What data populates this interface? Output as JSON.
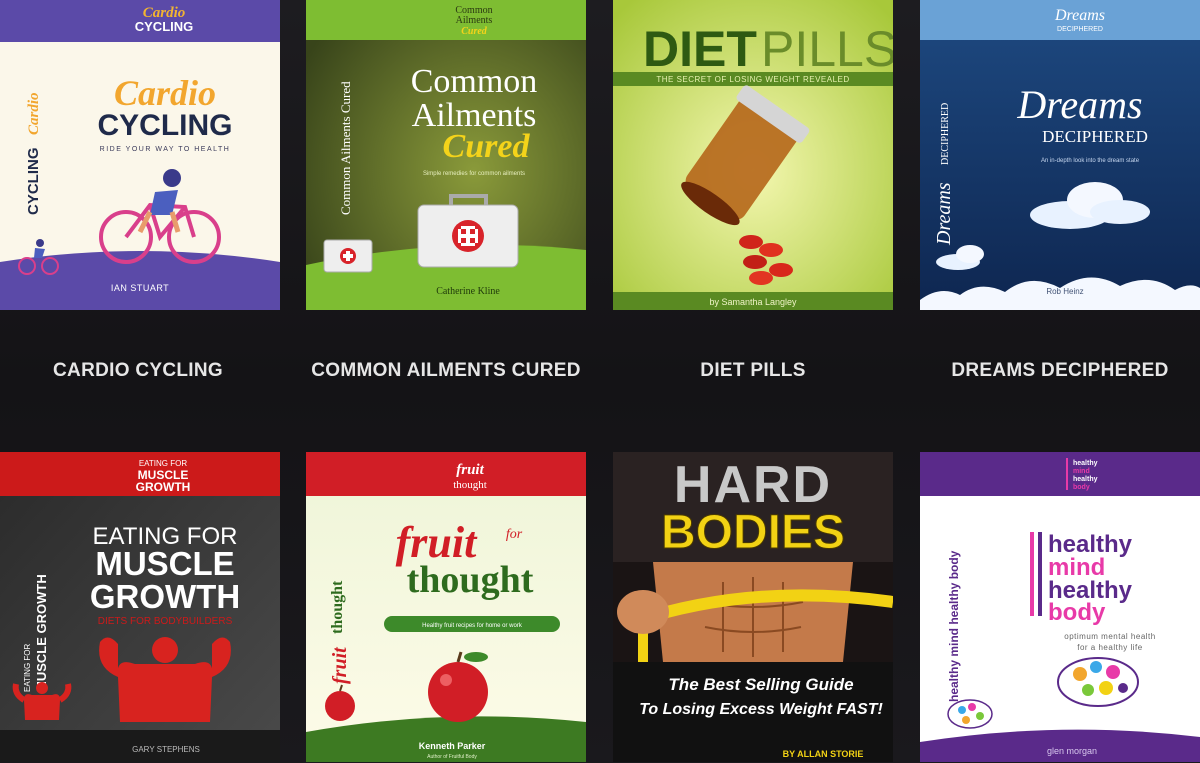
{
  "books": [
    {
      "caption": "CARDIO CYCLING",
      "cover": {
        "header_script": "Cardio",
        "header_word": "CYCLING",
        "title_script": "Cardio",
        "title_word": "CYCLING",
        "subtitle": "RIDE YOUR WAY TO HEALTH",
        "spine_word": "CYCLING",
        "spine_script": "Cardio",
        "author": "IAN STUART"
      }
    },
    {
      "caption": "COMMON AILMENTS CURED",
      "cover": {
        "header_line1": "Common",
        "header_line2": "Ailments",
        "header_line3": "Cured",
        "title_line1": "Common",
        "title_line2": "Ailments",
        "title_script": "Cured",
        "subtitle": "Simple remedies for common ailments",
        "spine": "Common Ailments Cured",
        "author": "Catherine Kline"
      }
    },
    {
      "caption": "DIET PILLS",
      "cover": {
        "title_a": "DIET",
        "title_b": "PILLS",
        "subtitle": "THE SECRET OF LOSING WEIGHT REVEALED",
        "author": "by Samantha Langley"
      }
    },
    {
      "caption": "DREAMS DECIPHERED",
      "cover": {
        "header_script": "Dreams",
        "header_word": "DECIPHERED",
        "title_script": "Dreams",
        "title_word": "DECIPHERED",
        "subtitle": "An in-depth look into the dream state",
        "spine_word": "DECIPHERED",
        "spine_script": "Dreams",
        "author": "Rob Heinz"
      }
    },
    {
      "caption": "",
      "cover": {
        "header_line1": "EATING FOR",
        "header_line2": "MUSCLE",
        "header_line3": "GROWTH",
        "title_line1": "EATING FOR",
        "title_line2": "MUSCLE",
        "title_line3": "GROWTH",
        "subtitle": "DIETS FOR BODYBUILDERS",
        "spine_a": "EATING FOR",
        "spine_b": "MUSCLE GROWTH",
        "author": "GARY STEPHENS"
      }
    },
    {
      "caption": "",
      "cover": {
        "header_script": "fruit",
        "header_word": "thought",
        "title_script": "fruit",
        "title_for": "for",
        "title_word": "thought",
        "subtitle": "Healthy fruit recipes for home or work",
        "spine_word": "thought",
        "spine_script": "fruit",
        "author": "Kenneth Parker",
        "author_note": "Author of Fruitful Body"
      }
    },
    {
      "caption": "",
      "cover": {
        "title_a": "HARD",
        "title_b": "BODIES",
        "tagline_1": "The Best Selling Guide",
        "tagline_2": "To Losing Excess Weight FAST!",
        "author": "BY ALLAN STORIE"
      }
    },
    {
      "caption": "",
      "cover": {
        "header_1": "healthy",
        "header_2": "mind",
        "header_3": "healthy",
        "header_4": "body",
        "title_1": "healthy",
        "title_2": "mind",
        "title_3": "healthy",
        "title_4": "body",
        "subtitle_1": "optimum mental health",
        "subtitle_2": "for a healthy life",
        "spine": "healthy mind healthy body",
        "author": "glen morgan"
      }
    }
  ],
  "colors": {
    "caption": "#e6e6e6",
    "background": "#161519"
  }
}
